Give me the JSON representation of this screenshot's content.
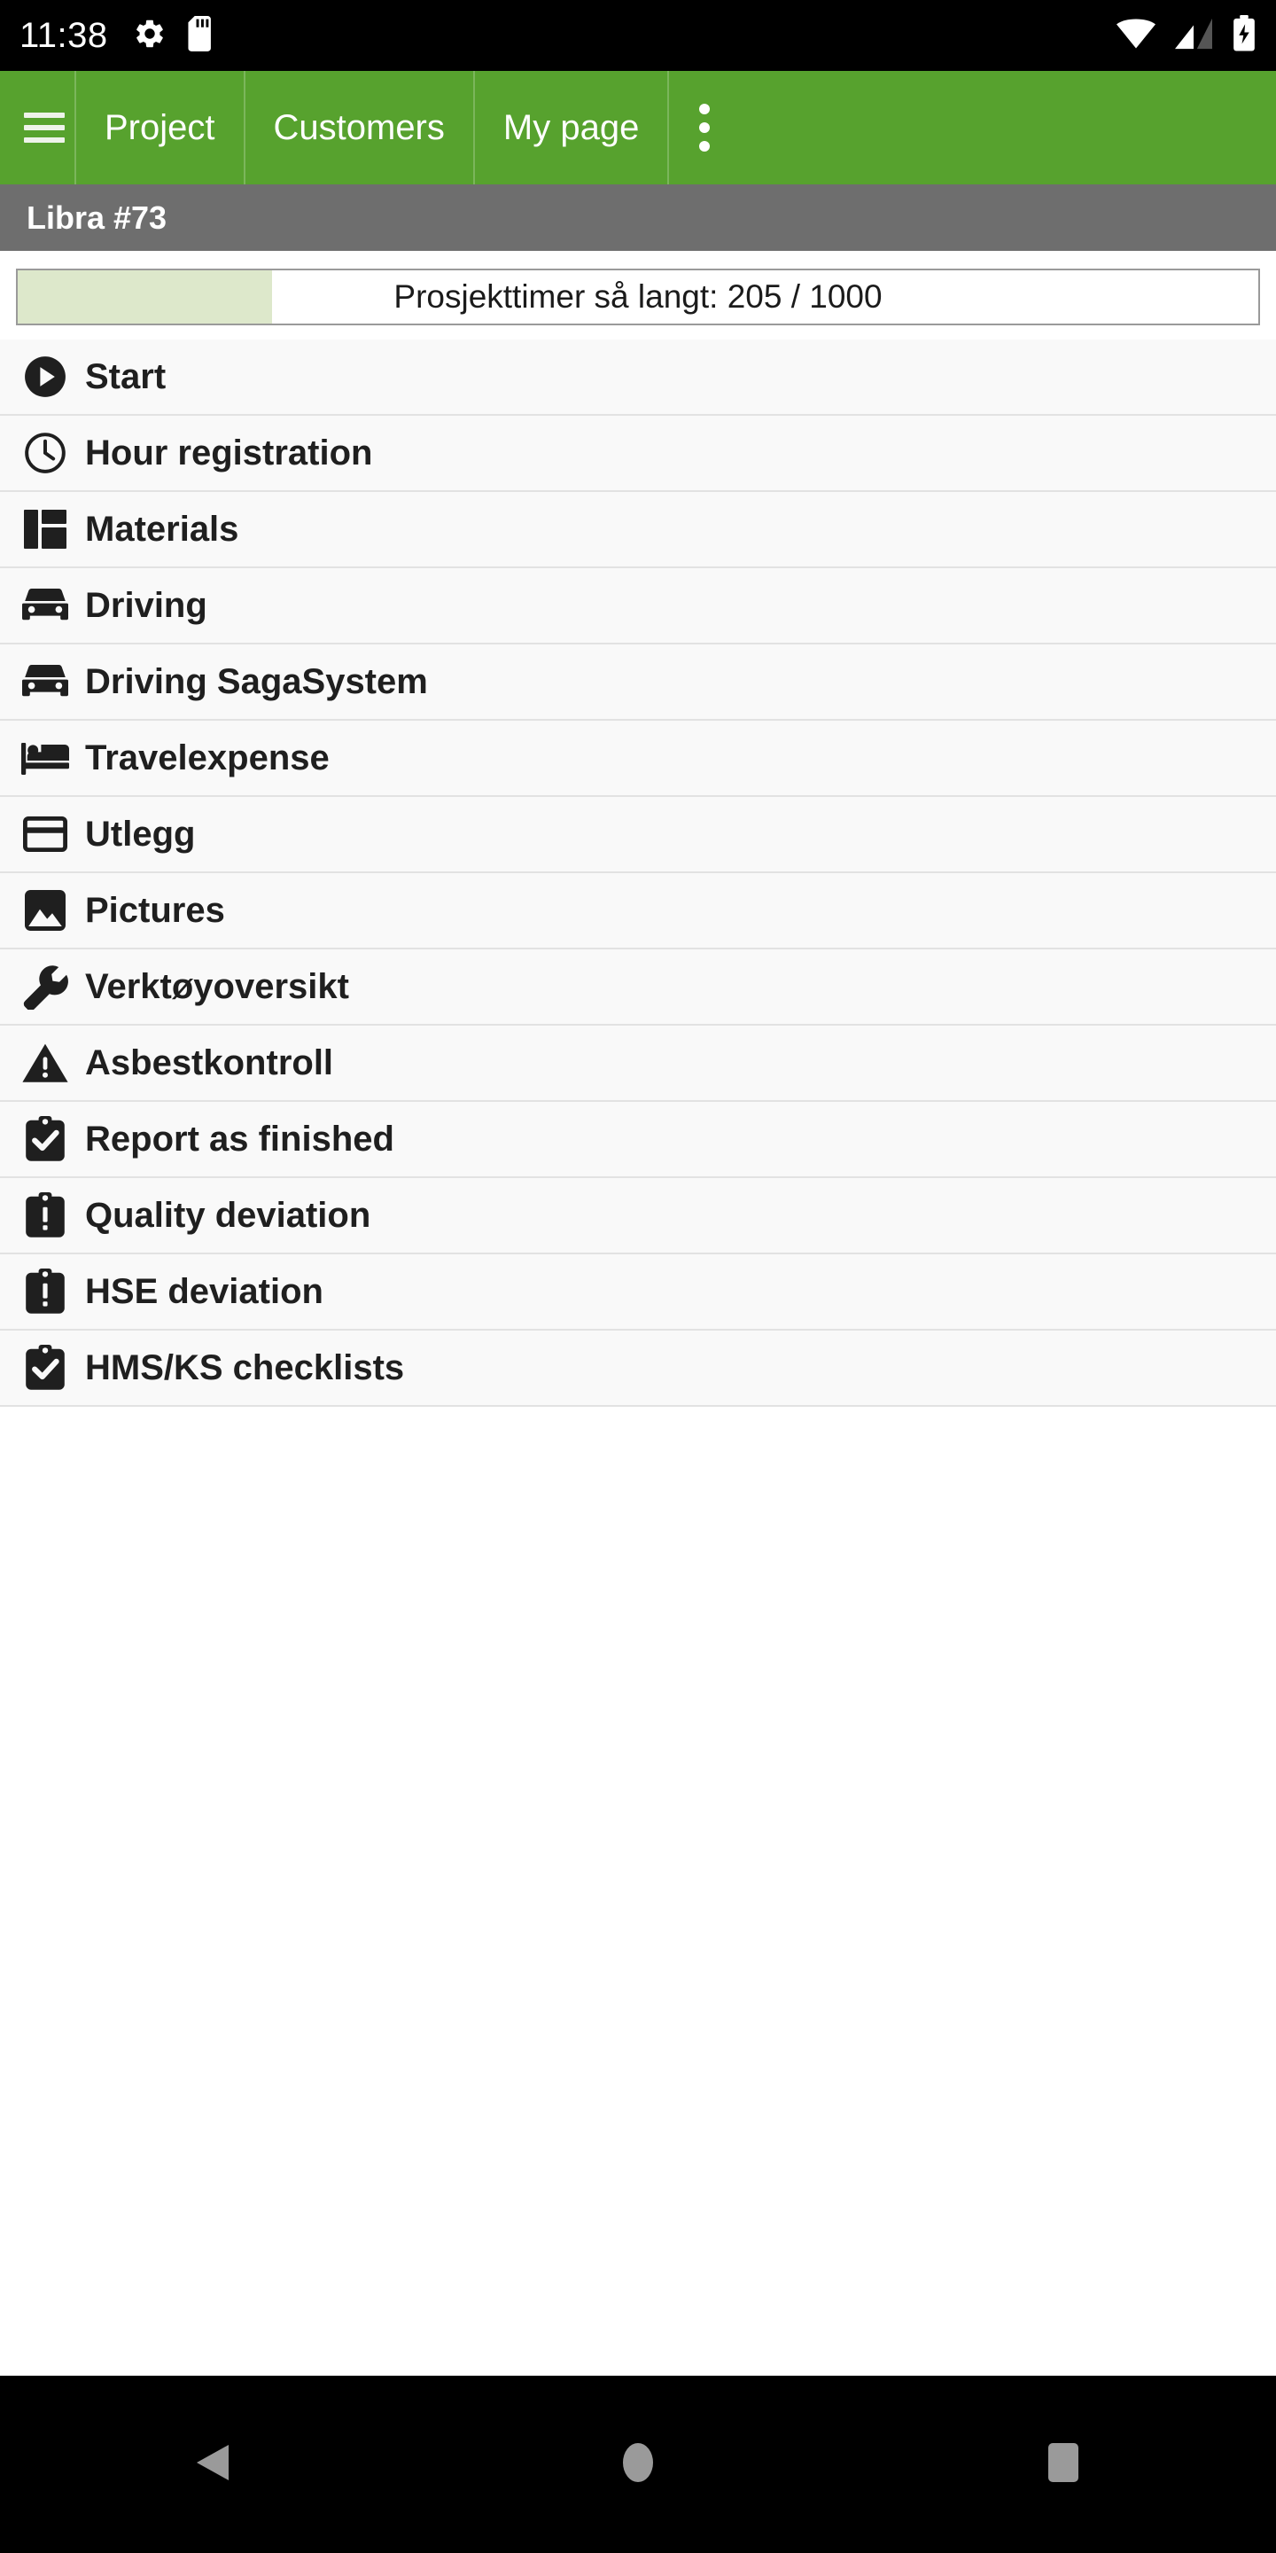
{
  "status_bar": {
    "time": "11:38",
    "left_icons": [
      "gear-icon",
      "sd-card-icon"
    ],
    "right_icons": [
      "wifi-icon",
      "cell-signal-icon",
      "battery-charging-icon"
    ],
    "background_color": "#000000"
  },
  "app_bar": {
    "background_color": "#57a22e",
    "menu_icon": "hamburger-menu-icon",
    "tabs": [
      {
        "label": "Project"
      },
      {
        "label": "Customers"
      },
      {
        "label": "My page"
      }
    ],
    "overflow_icon": "three-dot-overflow-icon"
  },
  "project_bar": {
    "title": "Libra #73",
    "background_color": "#6e6e6e"
  },
  "progress": {
    "label": "Prosjekttimer så langt: 205 / 1000",
    "current": 205,
    "total": 1000,
    "percent": 20.5,
    "fill_color": "#dde8cb",
    "border_color": "#9a9a9a"
  },
  "menu": {
    "items": [
      {
        "label": "Start",
        "icon": "play-circle-icon"
      },
      {
        "label": "Hour registration",
        "icon": "clock-icon"
      },
      {
        "label": "Materials",
        "icon": "dashboard-grid-icon"
      },
      {
        "label": "Driving",
        "icon": "car-icon"
      },
      {
        "label": "Driving SagaSystem",
        "icon": "car-icon"
      },
      {
        "label": "Travelexpense",
        "icon": "bed-icon"
      },
      {
        "label": "Utlegg",
        "icon": "credit-card-icon"
      },
      {
        "label": "Pictures",
        "icon": "image-icon"
      },
      {
        "label": "Verktøyoversikt",
        "icon": "wrench-icon"
      },
      {
        "label": "Asbestkontroll",
        "icon": "warning-triangle-icon"
      },
      {
        "label": "Report as finished",
        "icon": "clipboard-check-icon"
      },
      {
        "label": "Quality deviation",
        "icon": "clipboard-alert-icon"
      },
      {
        "label": "HSE deviation",
        "icon": "clipboard-alert-icon"
      },
      {
        "label": "HMS/KS checklists",
        "icon": "clipboard-check-icon"
      }
    ]
  },
  "system_nav": {
    "back": "back-triangle-icon",
    "home": "home-circle-icon",
    "recents": "recents-square-icon",
    "icon_color": "#9a9a9a"
  }
}
